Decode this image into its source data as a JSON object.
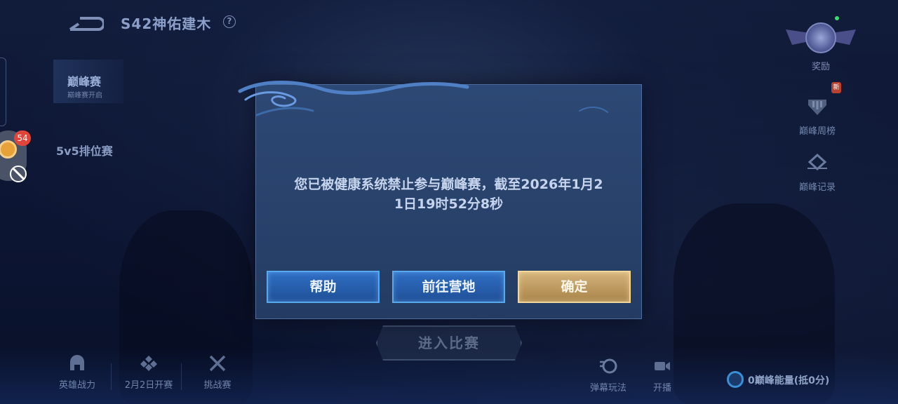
{
  "header": {
    "season_title": "S42神佑建木",
    "help_glyph": "?"
  },
  "left_nav": {
    "modes": [
      {
        "label": "巅峰赛",
        "sublabel": "巅峰赛开启"
      },
      {
        "label": "5v5排位赛"
      }
    ],
    "float_badge_count": "54"
  },
  "right_nav": {
    "reward_label": "奖励",
    "new_tag": "新",
    "weekly_rank_label": "巅峰周榜",
    "record_label": "巅峰记录"
  },
  "bottom_bar": {
    "items": [
      {
        "label": "英雄战力"
      },
      {
        "label": "2月2日开赛"
      },
      {
        "label": "挑战赛"
      },
      {
        "label": "弹幕玩法"
      },
      {
        "label": "开播"
      }
    ],
    "enter_match_label": "进入比赛",
    "energy_text": "0巅峰能量(抵0分)"
  },
  "dialog": {
    "message_line1": "您已被健康系统禁止参与巅峰赛，截至2026年1月2",
    "message_line2": "1日19时52分8秒",
    "buttons": {
      "help": "帮助",
      "camp": "前往营地",
      "confirm": "确定"
    }
  },
  "colors": {
    "dialog_bg": "#2c4874",
    "button_blue": "#2f6fc4",
    "button_gold": "#c9a86c",
    "badge_red": "#e0453a"
  }
}
